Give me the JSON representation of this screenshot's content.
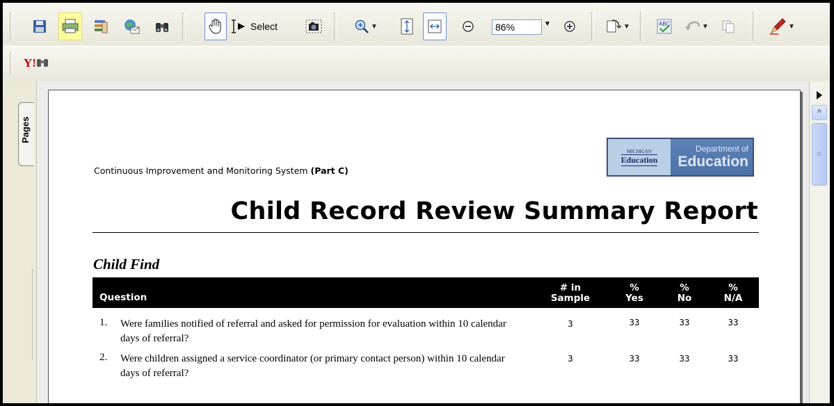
{
  "toolbar": {
    "select_label": "Select",
    "zoom_value": "86%"
  },
  "toolbar2": {
    "yahoo_label": "Y!"
  },
  "side_panel": {
    "pages_tab_label": "Pages"
  },
  "document": {
    "subtitle_plain": "Continuous Improvement and Monitoring System ",
    "subtitle_bold": "(Part C)",
    "logo": {
      "michigan_small": "MICHIGAN",
      "michigan_big": "Education",
      "dept_small": "Department of",
      "dept_big": "Education"
    },
    "report_title": "Child Record Review Summary Report",
    "section_title": "Child Find",
    "table": {
      "headers": {
        "question": "Question",
        "in_sample_1": "# in",
        "in_sample_2": "Sample",
        "yes_1": "%",
        "yes_2": "Yes",
        "no_1": "%",
        "no_2": "No",
        "na_1": "%",
        "na_2": "N/A"
      },
      "rows": [
        {
          "num": "1.",
          "question": "Were families notified of referral and asked for permission for evaluation within 10 calendar days of referral?",
          "sample": "3",
          "yes": "33",
          "no": "33",
          "na": "33"
        },
        {
          "num": "2.",
          "question": "Were children assigned a service coordinator (or primary contact person) within 10 calendar days of referral?",
          "sample": "3",
          "yes": "33",
          "no": "33",
          "na": "33"
        }
      ]
    }
  },
  "colors": {
    "table_header_bg": "#000000",
    "highlight": "#fffd9b",
    "logo_blue": "#4d72a8"
  }
}
